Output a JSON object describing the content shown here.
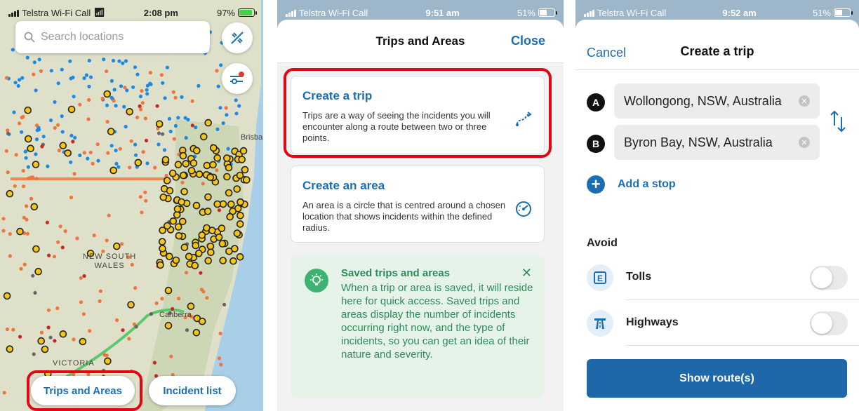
{
  "panel1": {
    "status": {
      "carrier": "Telstra Wi-Fi Call",
      "time": "2:08 pm",
      "battery": "97%",
      "battery_level": 0.97
    },
    "search": {
      "placeholder": "Search locations"
    },
    "map_labels": {
      "brisbane": "Brisbane",
      "nsw": "NEW SOUTH\nWALES",
      "canberra": "Canberra",
      "victoria": "VICTORIA"
    },
    "buttons": {
      "trips": "Trips and Areas",
      "incidents": "Incident list"
    },
    "icons": [
      "search-icon",
      "satellite-off-icon",
      "filter-icon"
    ]
  },
  "panel2": {
    "status": {
      "carrier": "Telstra Wi-Fi Call",
      "time": "9:51 am",
      "battery": "51%",
      "battery_level": 0.51
    },
    "header": {
      "title": "Trips and Areas",
      "close": "Close"
    },
    "create_trip": {
      "title": "Create a trip",
      "desc": "Trips are a way of seeing the incidents you will encounter along a route between two or three points."
    },
    "create_area": {
      "title": "Create an area",
      "desc": "An area is a circle that is centred around a chosen location that shows incidents within the defined radius."
    },
    "saved": {
      "title": "Saved trips and areas",
      "desc": "When a trip or area is saved, it will reside here for quick access. Saved trips and areas display the number of incidents occurring right now, and the type of incidents, so you can get an idea of their nature and severity."
    },
    "colors": {
      "accent": "#1c6eb3",
      "saved_green": "#2e8b57"
    }
  },
  "panel3": {
    "status": {
      "carrier": "Telstra Wi-Fi Call",
      "time": "9:52 am",
      "battery": "51%",
      "battery_level": 0.51
    },
    "header": {
      "cancel": "Cancel",
      "title": "Create a trip"
    },
    "stops": [
      {
        "letter": "A",
        "value": "Wollongong, NSW, Australia"
      },
      {
        "letter": "B",
        "value": "Byron Bay, NSW, Australia"
      }
    ],
    "add_stop": "Add a stop",
    "avoid_label": "Avoid",
    "options": [
      {
        "label": "Tolls",
        "icon": "toll-icon",
        "enabled": false
      },
      {
        "label": "Highways",
        "icon": "highway-icon",
        "enabled": false
      }
    ],
    "show_route": "Show route(s)"
  }
}
